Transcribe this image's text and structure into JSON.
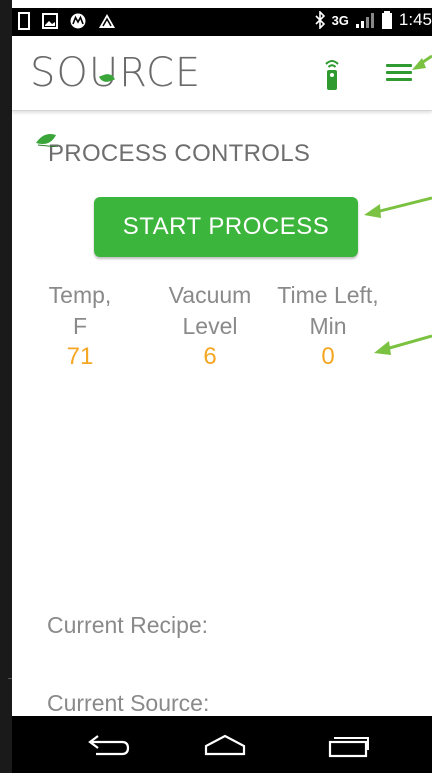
{
  "status_bar": {
    "network": "3G",
    "time": "1:45",
    "left_icons": [
      "notification-square-icon",
      "image-icon",
      "motorola-icon",
      "alert-triangle-icon"
    ]
  },
  "app_bar": {
    "logo_text": "SOURCE",
    "icons": [
      "remote-signal-icon",
      "hamburger-menu-icon"
    ]
  },
  "process_controls": {
    "title": "PROCESS CONTROLS",
    "start_button_label": "START PROCESS",
    "metrics": [
      {
        "label_line1": "Temp,",
        "label_line2": "F",
        "value": "71"
      },
      {
        "label_line1": "Vacuum",
        "label_line2": "Level",
        "value": "6"
      },
      {
        "label_line1": "Time Left,",
        "label_line2": "Min",
        "value": "0"
      }
    ]
  },
  "info": {
    "current_recipe_label": "Current Recipe:",
    "current_source_label": "Current Source:"
  },
  "colors": {
    "accent_green": "#3cb53c",
    "value_orange": "#f5a623",
    "label_gray": "#8a8a8a",
    "annotation_arrow": "#7cc242"
  }
}
